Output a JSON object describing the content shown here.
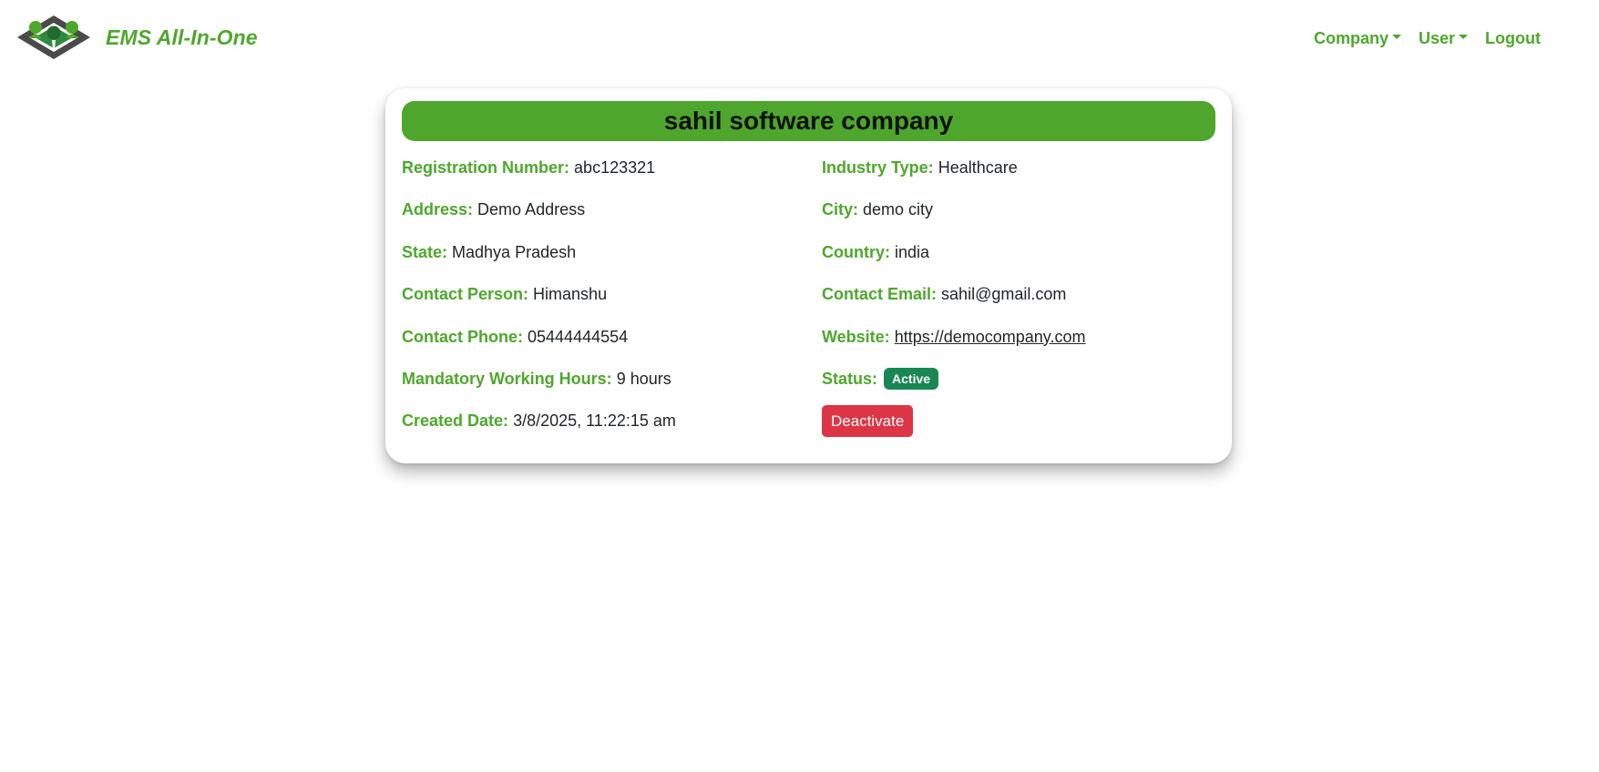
{
  "navbar": {
    "brand_name": "EMS All-In-One",
    "logo_icon": "ems-logo-icon",
    "links": {
      "company": "Company",
      "user": "User",
      "logout": "Logout"
    }
  },
  "company": {
    "name": "sahil software company",
    "left_fields": [
      {
        "label": "Registration Number:",
        "value": "abc123321"
      },
      {
        "label": "Address:",
        "value": "Demo Address"
      },
      {
        "label": "State:",
        "value": "Madhya Pradesh"
      },
      {
        "label": "Contact Person:",
        "value": "Himanshu"
      },
      {
        "label": "Contact Phone:",
        "value": "05444444554"
      },
      {
        "label": "Mandatory Working Hours:",
        "value": "9 hours"
      },
      {
        "label": "Created Date:",
        "value": "3/8/2025, 11:22:15 am"
      }
    ],
    "right_fields": [
      {
        "label": "Industry Type:",
        "value": "Healthcare"
      },
      {
        "label": "City:",
        "value": "demo city"
      },
      {
        "label": "Country:",
        "value": "india"
      },
      {
        "label": "Contact Email:",
        "value": "sahil@gmail.com"
      },
      {
        "label": "Website:",
        "value": "https://democompany.com"
      },
      {
        "label": "Status:",
        "value": "Active"
      }
    ],
    "deactivate_label": "Deactivate"
  },
  "colors": {
    "brand_green": "#4ea72c",
    "status_active": "#198754",
    "danger": "#dc3545"
  }
}
